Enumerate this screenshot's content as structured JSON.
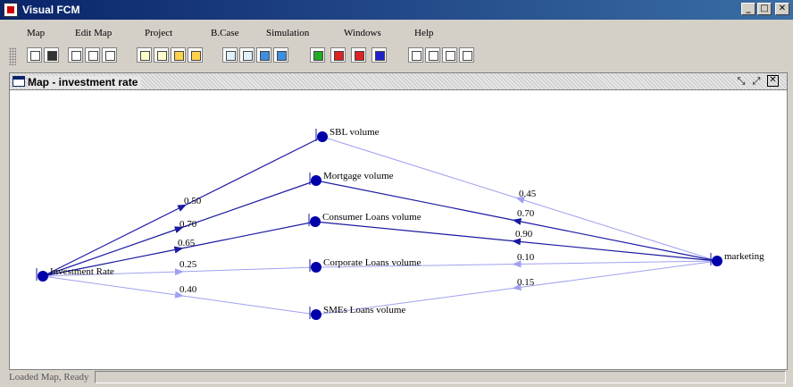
{
  "app": {
    "title": "Visual FCM"
  },
  "menu": [
    "Map",
    "Edit Map",
    "Project",
    "B.Case",
    "Simulation",
    "Windows",
    "Help"
  ],
  "toolbar_icons": [
    "new-icon",
    "save-icon",
    "cut-icon",
    "copy-icon",
    "paste-icon",
    "doc-icon",
    "doc-edit-icon",
    "add-node-icon",
    "remove-node-icon",
    "page-icon",
    "page-edit-icon",
    "add-edge-icon",
    "remove-edge-icon",
    "green-flag-icon",
    "red-flag-icon",
    "red-green-flag-icon",
    "blue-flag-icon",
    "network-icon",
    "clipboard-icon",
    "printer-icon",
    "table-icon"
  ],
  "document": {
    "title": "Map - investment rate"
  },
  "map": {
    "nodes": [
      {
        "id": "investment",
        "label": "Investment Rate"
      },
      {
        "id": "sbl",
        "label": "SBL volume"
      },
      {
        "id": "mortgage",
        "label": "Mortgage volume"
      },
      {
        "id": "consumer",
        "label": "Consumer Loans volume"
      },
      {
        "id": "corporate",
        "label": "Corporate Loans volume"
      },
      {
        "id": "smes",
        "label": "SMEs Loans volume"
      },
      {
        "id": "marketing",
        "label": "marketing"
      }
    ],
    "edges": [
      {
        "from": "investment",
        "to": "sbl",
        "weight": "0.50",
        "color": "#1a1aa0"
      },
      {
        "from": "investment",
        "to": "mortgage",
        "weight": "0.70",
        "color": "#1a1aa0"
      },
      {
        "from": "investment",
        "to": "consumer",
        "weight": "0.65",
        "color": "#1a1aa0"
      },
      {
        "from": "investment",
        "to": "corporate",
        "weight": "0.25",
        "color": "#a0a0f0"
      },
      {
        "from": "investment",
        "to": "smes",
        "weight": "0.40",
        "color": "#a0a0f0"
      },
      {
        "from": "marketing",
        "to": "sbl",
        "weight": "0.45",
        "color": "#a0a0f0"
      },
      {
        "from": "marketing",
        "to": "mortgage",
        "weight": "0.70",
        "color": "#1a1aa0"
      },
      {
        "from": "marketing",
        "to": "consumer",
        "weight": "0.90",
        "color": "#1a1aa0"
      },
      {
        "from": "marketing",
        "to": "corporate",
        "weight": "0.10",
        "color": "#a0a0f0"
      },
      {
        "from": "marketing",
        "to": "smes",
        "weight": "0.15",
        "color": "#a0a0f0"
      }
    ]
  },
  "status": {
    "text": "Loaded Map, Ready"
  },
  "colors": {
    "titlebar": "#0a246a",
    "node": "#0000aa",
    "strong_edge": "#1a1aa0",
    "weak_edge": "#a0a0f0"
  }
}
